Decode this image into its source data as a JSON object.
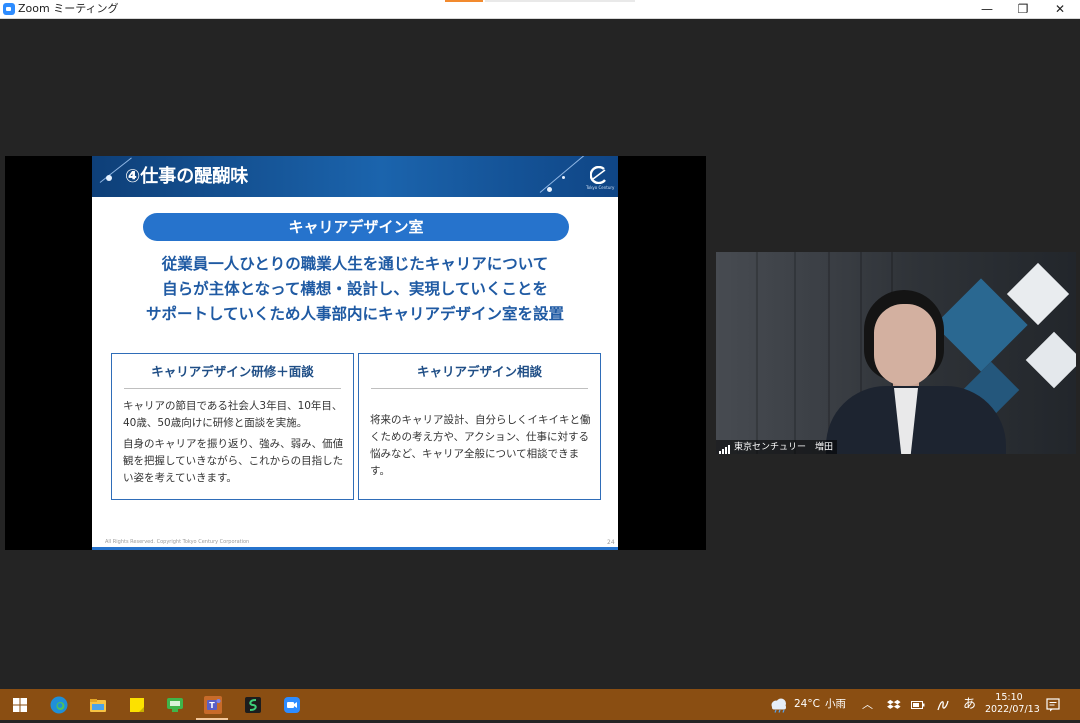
{
  "window": {
    "title": "Zoom ミーティング",
    "controls": {
      "minimize": "—",
      "restore": "❐",
      "close": "✕"
    }
  },
  "slide": {
    "title": "④仕事の醍醐味",
    "pill": "キャリアデザイン室",
    "main_lines": [
      "従業員一人ひとりの職業人生を通じたキャリアについて",
      "自らが主体となって構想・設計し、実現していくことを",
      "サポートしていくため人事部内にキャリアデザイン室を設置"
    ],
    "box_left": {
      "title": "キャリアデザイン研修＋面談",
      "para1": "キャリアの節目である社会人3年目、10年目、40歳、50歳向けに研修と面談を実施。",
      "para2": "自身のキャリアを振り返り、強み、弱み、価値観を把握していきながら、これからの目指したい姿を考えていきます。"
    },
    "box_right": {
      "title": "キャリアデザイン相談",
      "para1": "将来のキャリア設計、自分らしくイキイキと働くための考え方や、アクション、仕事に対する悩みなど、キャリア全般について相談できます。"
    },
    "footer": "All Rights Reserved.   Copyright Tokyo Century Corporation",
    "page_number": "24",
    "logo_text": "Tokyo Century"
  },
  "video": {
    "participant_name": "東京センチュリー　増田"
  },
  "taskbar": {
    "apps": [
      "start-icon",
      "edge-icon",
      "file-explorer-icon",
      "sticky-notes-icon",
      "chat-icon",
      "teams-icon",
      "stream-icon",
      "zoom-icon"
    ],
    "weather_temp": "24°C",
    "weather_text": "小雨",
    "ime": "あ",
    "time": "15:10",
    "date": "2022/07/13"
  }
}
